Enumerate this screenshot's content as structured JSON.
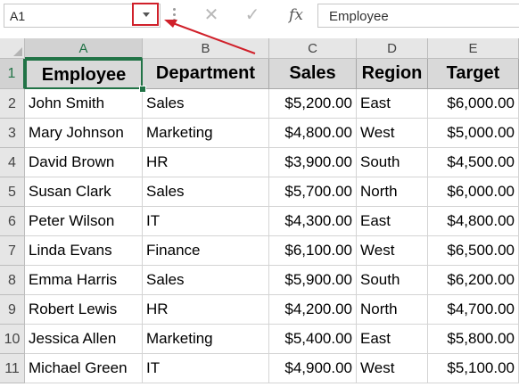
{
  "name_box": {
    "value": "A1"
  },
  "formula_bar": {
    "cancel_glyph": "✕",
    "enter_glyph": "✓",
    "fx_label": "fx",
    "value": "Employee"
  },
  "columns": [
    "A",
    "B",
    "C",
    "D",
    "E"
  ],
  "rows": [
    "1",
    "2",
    "3",
    "4",
    "5",
    "6",
    "7",
    "8",
    "9",
    "10",
    "11"
  ],
  "sheet": {
    "header": [
      "Employee",
      "Department",
      "Sales",
      "Region",
      "Target"
    ],
    "data": [
      [
        "John Smith",
        "Sales",
        "$5,200.00",
        "East",
        "$6,000.00"
      ],
      [
        "Mary Johnson",
        "Marketing",
        "$4,800.00",
        "West",
        "$5,000.00"
      ],
      [
        "David Brown",
        "HR",
        "$3,900.00",
        "South",
        "$4,500.00"
      ],
      [
        "Susan Clark",
        "Sales",
        "$5,700.00",
        "North",
        "$6,000.00"
      ],
      [
        "Peter Wilson",
        "IT",
        "$4,300.00",
        "East",
        "$4,800.00"
      ],
      [
        "Linda Evans",
        "Finance",
        "$6,100.00",
        "West",
        "$6,500.00"
      ],
      [
        "Emma Harris",
        "Sales",
        "$5,900.00",
        "South",
        "$6,200.00"
      ],
      [
        "Robert Lewis",
        "HR",
        "$4,200.00",
        "North",
        "$4,700.00"
      ],
      [
        "Jessica Allen",
        "Marketing",
        "$5,400.00",
        "East",
        "$5,800.00"
      ],
      [
        "Michael Green",
        "IT",
        "$4,900.00",
        "West",
        "$5,100.00"
      ]
    ]
  },
  "colors": {
    "selection": "#217346",
    "highlight": "#d0202a",
    "header_fill": "#d9d9d9"
  },
  "icons": {
    "name_box_dropdown": "chevron-down-icon",
    "cancel": "close-icon",
    "enter": "check-icon",
    "function": "fx-icon",
    "annotation": "arrow-icon"
  }
}
